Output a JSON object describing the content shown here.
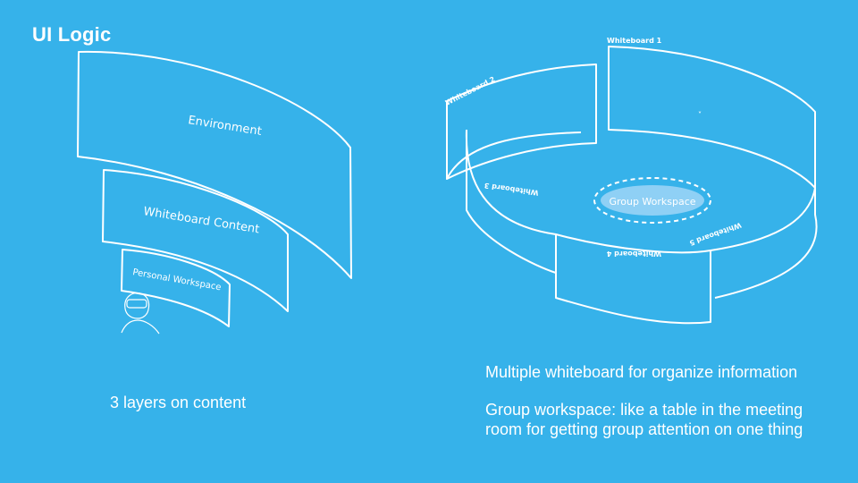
{
  "slide": {
    "title": "UI Logic",
    "left_caption": "3 layers on content",
    "right_caption_line1": "Multiple whiteboard for organize information",
    "right_caption_line2": "Group workspace: like a table in the meeting room for getting group attention on one thing"
  },
  "layers": {
    "environment": "Environment",
    "whiteboard_content": "Whiteboard Content",
    "personal_workspace": "Personal Workspace"
  },
  "whiteboards": {
    "wb1": "Whiteboard 1",
    "wb2": "Whiteboard 2",
    "wb3": "Whiteboard 3",
    "wb4": "Whiteboard 4",
    "wb5": "Whiteboard 5",
    "group": "Group Workspace"
  },
  "colors": {
    "background": "#36b2ea",
    "lines": "#ffffff",
    "group_fill": "#8fd0f5"
  }
}
